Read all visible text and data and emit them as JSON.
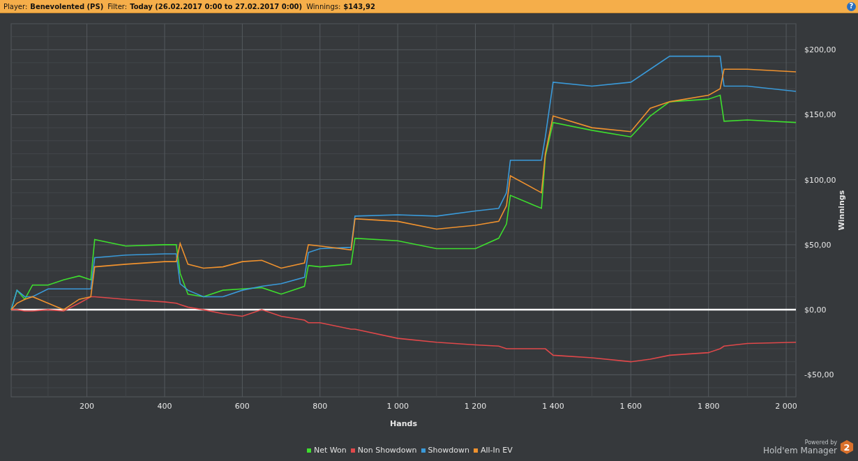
{
  "header": {
    "fields": [
      {
        "label": "Player:",
        "value": "Benevolented (PS)"
      },
      {
        "label": "Filter:",
        "value": "Today (26.02.2017 0:00 to 27.02.2017 0:00)"
      },
      {
        "label": "Winnings:",
        "value": "$143,92"
      }
    ],
    "help": "?"
  },
  "graph": {
    "chart_data": {
      "type": "line",
      "grid": true,
      "xlabel": "Hands",
      "ylabel": "Winnings",
      "xlim": [
        5,
        2025
      ],
      "ylim": [
        -67,
        220
      ],
      "xticks": [
        {
          "value": 200,
          "label": "200"
        },
        {
          "value": 400,
          "label": "400"
        },
        {
          "value": 600,
          "label": "600"
        },
        {
          "value": 800,
          "label": "800"
        },
        {
          "value": 1000,
          "label": "1 000"
        },
        {
          "value": 1200,
          "label": "1 200"
        },
        {
          "value": 1400,
          "label": "1 400"
        },
        {
          "value": 1600,
          "label": "1 600"
        },
        {
          "value": 1800,
          "label": "1 800"
        },
        {
          "value": 2000,
          "label": "2 000"
        }
      ],
      "yticks": [
        {
          "value": -50,
          "label": "-$50,00"
        },
        {
          "value": 0,
          "label": "$0,00"
        },
        {
          "value": 50,
          "label": "$50,00"
        },
        {
          "value": 100,
          "label": "$100,00"
        },
        {
          "value": 150,
          "label": "$150,00"
        },
        {
          "value": 200,
          "label": "$200,00"
        }
      ],
      "x": [
        5,
        20,
        40,
        60,
        100,
        140,
        180,
        210,
        220,
        300,
        400,
        430,
        440,
        460,
        500,
        550,
        600,
        650,
        700,
        760,
        770,
        800,
        880,
        890,
        1000,
        1100,
        1200,
        1260,
        1280,
        1290,
        1370,
        1380,
        1400,
        1500,
        1600,
        1650,
        1700,
        1800,
        1830,
        1840,
        1900,
        2025
      ],
      "series": [
        {
          "name": "Net Won",
          "color": "#3ede2e",
          "values": [
            0,
            15,
            8,
            19,
            19,
            23,
            26,
            23,
            54,
            49,
            50,
            50,
            28,
            12,
            10,
            15,
            16,
            17,
            12,
            18,
            34,
            33,
            35,
            55,
            53,
            47,
            47,
            55,
            66,
            88,
            78,
            118,
            144,
            138,
            133,
            149,
            160,
            162,
            165,
            145,
            146,
            144
          ]
        },
        {
          "name": "Non Showdown",
          "color": "#e0484a",
          "values": [
            0,
            0,
            -1,
            -1,
            0,
            -1,
            5,
            10,
            10,
            8,
            6,
            5,
            4,
            2,
            0,
            -3,
            -5,
            0,
            -5,
            -8,
            -10,
            -10,
            -15,
            -15,
            -22,
            -25,
            -27,
            -28,
            -30,
            -30,
            -30,
            -30,
            -35,
            -37,
            -40,
            -38,
            -35,
            -33,
            -30,
            -28,
            -26,
            -25
          ]
        },
        {
          "name": "Showdown",
          "color": "#3a9ad9",
          "values": [
            0,
            15,
            10,
            10,
            16,
            16,
            16,
            16,
            40,
            42,
            43,
            43,
            20,
            15,
            10,
            10,
            15,
            18,
            20,
            25,
            44,
            47,
            48,
            72,
            73,
            72,
            76,
            78,
            90,
            115,
            115,
            133,
            175,
            172,
            175,
            185,
            195,
            195,
            195,
            172,
            172,
            168
          ]
        },
        {
          "name": "All-In EV",
          "color": "#f0922e",
          "values": [
            0,
            5,
            8,
            10,
            5,
            0,
            8,
            10,
            33,
            35,
            37,
            37,
            51,
            35,
            32,
            33,
            37,
            38,
            32,
            36,
            50,
            49,
            46,
            70,
            68,
            62,
            65,
            68,
            80,
            103,
            90,
            120,
            149,
            140,
            137,
            155,
            160,
            165,
            170,
            185,
            185,
            183
          ]
        }
      ]
    }
  },
  "branding": {
    "caption": "Powered by",
    "name": "Hold'em Manager",
    "badge": "2"
  }
}
